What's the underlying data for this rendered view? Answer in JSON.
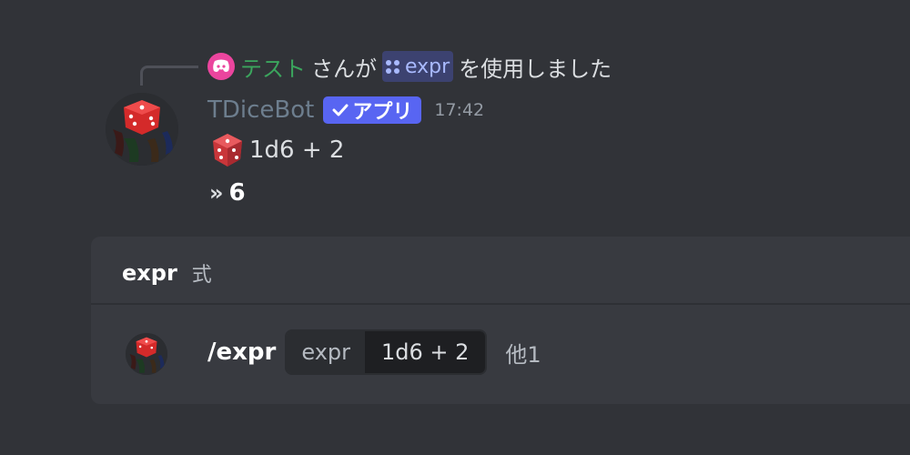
{
  "reply": {
    "user": "テスト",
    "text_mid": "さんが",
    "command": "expr",
    "text_end": "を使用しました"
  },
  "message": {
    "username": "TDiceBot",
    "badge": "アプリ",
    "timestamp": "17:42",
    "roll_expr": "1d6 + 2",
    "result": "6"
  },
  "command_panel": {
    "command_name": "expr",
    "command_desc": "式",
    "slash_command": "/expr",
    "option_name": "expr",
    "option_value": "1d6 + 2",
    "more_options": "他1"
  },
  "colors": {
    "background": "#313338",
    "panel": "#383a40",
    "brand": "#5865f2",
    "reply_user": "#3ba55d",
    "mention": "#a9baff"
  },
  "icons": [
    "discord-icon",
    "apps-icon",
    "check-icon",
    "dice-icon",
    "avatar-dice-icon",
    "double-chevron-icon"
  ]
}
